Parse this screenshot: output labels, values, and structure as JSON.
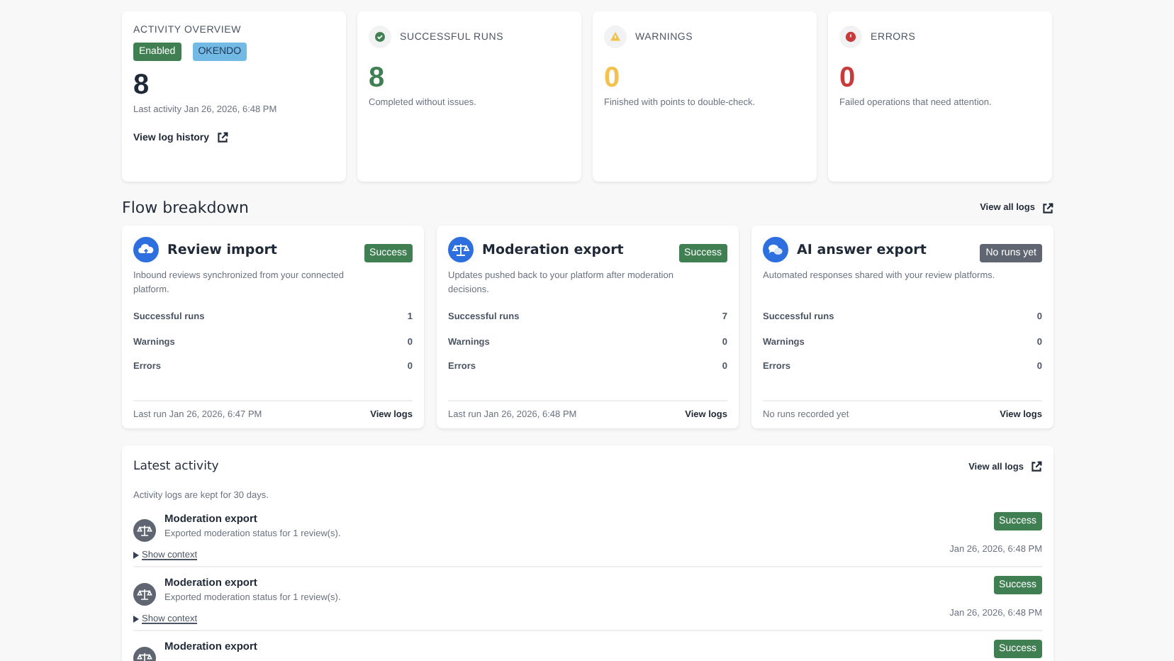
{
  "overview": {
    "label": "ACTIVITY OVERVIEW",
    "badges": [
      {
        "text": "Enabled",
        "kind": "success"
      },
      {
        "text": "OKENDO",
        "kind": "info"
      }
    ],
    "value": "8",
    "last_activity": "Last activity Jan 26, 2026, 6:48 PM",
    "link": "View log history"
  },
  "stats": [
    {
      "kind": "success",
      "label": "SUCCESSFUL RUNS",
      "value": "8",
      "description": "Completed without issues."
    },
    {
      "kind": "warning",
      "label": "WARNINGS",
      "value": "0",
      "description": "Finished with points to double-check."
    },
    {
      "kind": "error",
      "label": "ERRORS",
      "value": "0",
      "description": "Failed operations that need attention."
    }
  ],
  "flow_breakdown": {
    "title": "Flow breakdown",
    "link": "View all logs",
    "cards": [
      {
        "kind": "import",
        "title": "Review import",
        "status": {
          "text": "Success",
          "kind": "success"
        },
        "description": "Inbound reviews synchronized from your connected platform.",
        "metrics": [
          {
            "label": "Successful runs",
            "value": "1"
          },
          {
            "label": "Warnings",
            "value": "0"
          },
          {
            "label": "Errors",
            "value": "0"
          }
        ],
        "footer": "Last run Jan 26, 2026, 6:47 PM",
        "link": "View logs"
      },
      {
        "kind": "moderation",
        "title": "Moderation export",
        "status": {
          "text": "Success",
          "kind": "success"
        },
        "description": "Updates pushed back to your platform after moderation decisions.",
        "metrics": [
          {
            "label": "Successful runs",
            "value": "7"
          },
          {
            "label": "Warnings",
            "value": "0"
          },
          {
            "label": "Errors",
            "value": "0"
          }
        ],
        "footer": "Last run Jan 26, 2026, 6:48 PM",
        "link": "View logs"
      },
      {
        "kind": "answers",
        "title": "AI answer export",
        "status": {
          "text": "No runs yet",
          "kind": "neutral"
        },
        "description": "Automated responses shared with your review platforms.",
        "metrics": [
          {
            "label": "Successful runs",
            "value": "0"
          },
          {
            "label": "Warnings",
            "value": "0"
          },
          {
            "label": "Errors",
            "value": "0"
          }
        ],
        "footer": "No runs recorded yet",
        "link": "View logs"
      }
    ]
  },
  "latest_activity": {
    "title": "Latest activity",
    "link": "View all logs",
    "note": "Activity logs are kept for 30 days.",
    "entries": [
      {
        "title": "Moderation export",
        "description": "Exported moderation status for 1 review(s).",
        "status": {
          "text": "Success",
          "kind": "success"
        },
        "time": "Jan 26, 2026, 6:48 PM",
        "context_link": "Show context"
      },
      {
        "title": "Moderation export",
        "description": "Exported moderation status for 1 review(s).",
        "status": {
          "text": "Success",
          "kind": "success"
        },
        "time": "Jan 26, 2026, 6:48 PM",
        "context_link": "Show context"
      },
      {
        "title": "Moderation export",
        "status": {
          "text": "Success",
          "kind": "success"
        }
      }
    ]
  }
}
